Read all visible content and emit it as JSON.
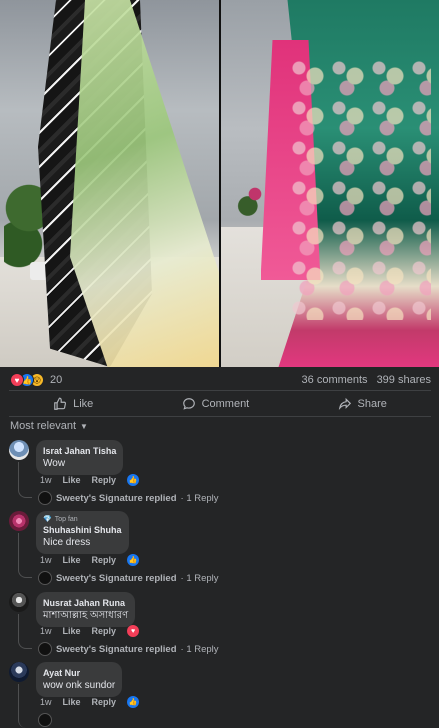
{
  "post": {
    "reaction_count": "20",
    "comments": "36 comments",
    "shares": "399 shares"
  },
  "actions": {
    "like": "Like",
    "comment": "Comment",
    "share": "Share"
  },
  "sort": {
    "label": "Most relevant"
  },
  "comments": [
    {
      "name": "Israt Jahan Tisha",
      "text": "Wow",
      "time": "1w",
      "like": "Like",
      "reply": "Reply",
      "reaction": "like",
      "reply_author": "Sweety's Signature replied",
      "reply_meta": "· 1 Reply"
    },
    {
      "badge": "Top fan",
      "name": "Shuhashini Shuha",
      "text": "Nice dress",
      "time": "1w",
      "like": "Like",
      "reply": "Reply",
      "reaction": "like",
      "reply_author": "Sweety's Signature replied",
      "reply_meta": "· 1 Reply"
    },
    {
      "name": "Nusrat Jahan Runa",
      "text": "মাশাআল্লাহ অসাধারণ",
      "time": "1w",
      "like": "Like",
      "reply": "Reply",
      "reaction": "heart",
      "reply_author": "Sweety's Signature replied",
      "reply_meta": "· 1 Reply"
    },
    {
      "name": "Ayat Nur",
      "text": "wow onk sundor",
      "time": "1w",
      "like": "Like",
      "reply": "Reply",
      "reaction": "like"
    }
  ]
}
